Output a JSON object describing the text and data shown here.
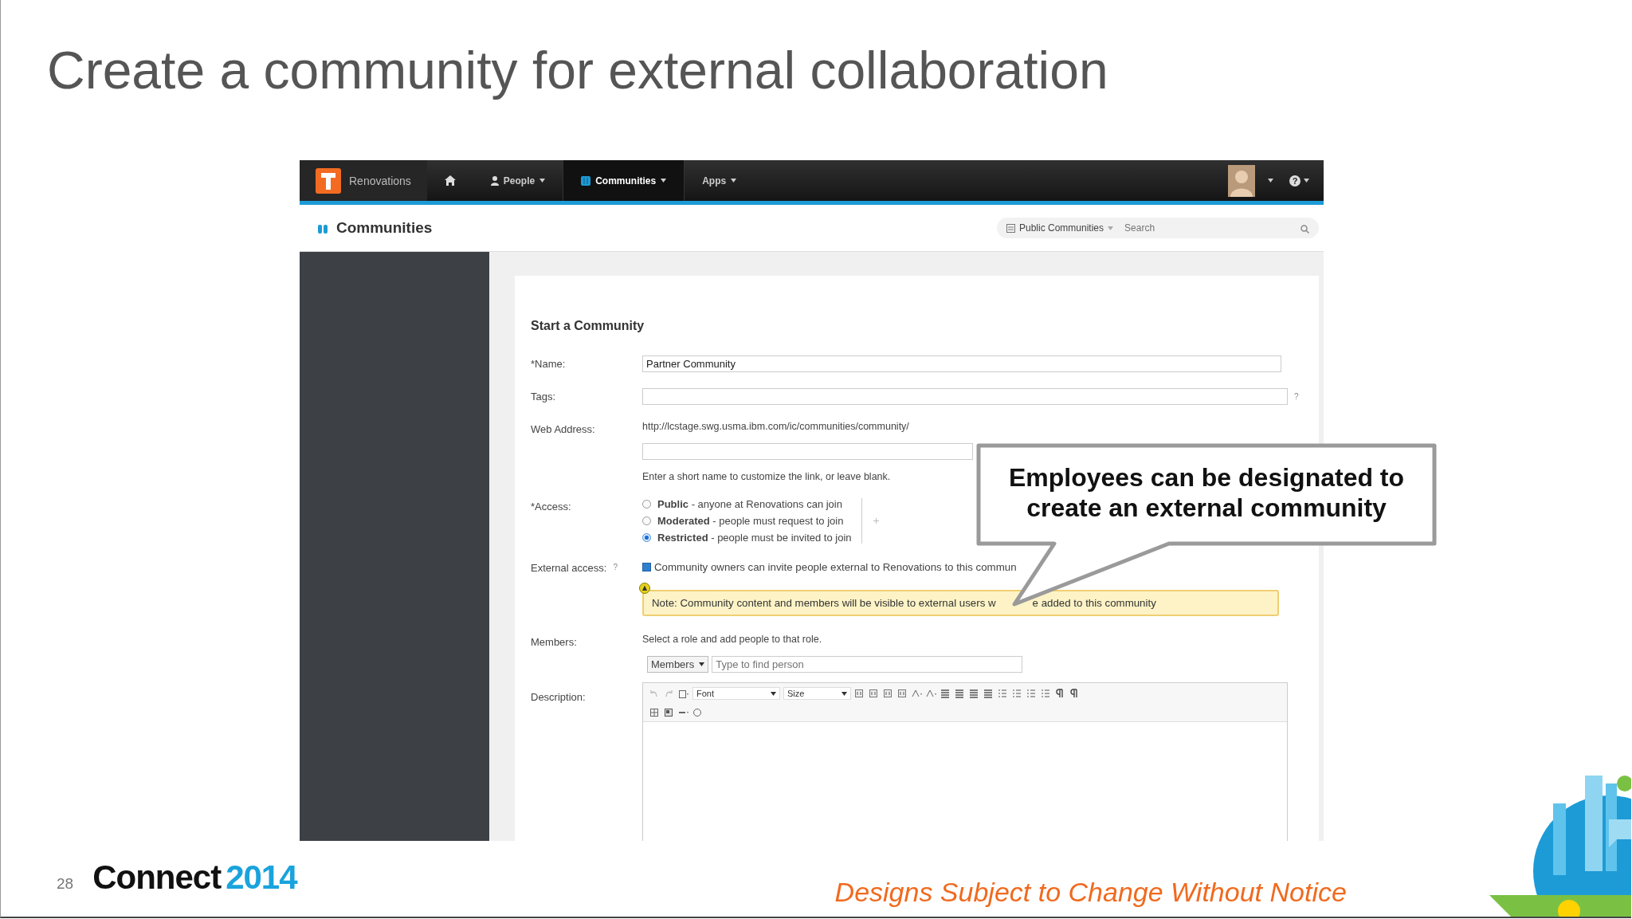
{
  "slide": {
    "title": "Create a community for external collaboration",
    "page_number": "28",
    "brand_word": "Connect",
    "brand_year": "2014",
    "disclaimer": "Designs Subject to Change Without Notice"
  },
  "app": {
    "nav": {
      "brand": "Renovations",
      "items": [
        {
          "label": "People",
          "kind": "person",
          "selected": false
        },
        {
          "label": "Communities",
          "kind": "apps",
          "selected": true
        },
        {
          "label": "Apps",
          "kind": "plain",
          "selected": false
        }
      ],
      "help": "?"
    },
    "header": {
      "title": "Communities",
      "scope": "Public Communities",
      "search": {
        "placeholder": "Search"
      }
    },
    "form": {
      "title": "Start a Community",
      "name": {
        "label": "*Name:",
        "value": "Partner Community"
      },
      "tags": {
        "label": "Tags:",
        "help": "?"
      },
      "web_address": {
        "label": "Web Address:",
        "url": "http://lcstage.swg.usma.ibm.com/ic/communities/community/",
        "hint": "Enter a short name to customize the link, or leave blank."
      },
      "access": {
        "label": "*Access:",
        "options": [
          {
            "name": "Public",
            "description": " - anyone at Renovations can join",
            "selected": false
          },
          {
            "name": "Moderated",
            "description": " - people must request to join",
            "selected": false
          },
          {
            "name": "Restricted",
            "description": " - people must be invited to join",
            "selected": true
          }
        ]
      },
      "external": {
        "label": "External access:",
        "help": "?",
        "checked": true,
        "text": "Community owners can invite people external to Renovations to this commun"
      },
      "note": {
        "parts": [
          "Note: Community content and members will be visible to external users w",
          "e added to this community"
        ]
      },
      "members": {
        "label": "Members:",
        "hint": "Select a role and add people to that role.",
        "role": "Members",
        "placeholder": "Type to find person"
      },
      "description": {
        "label": "Description:",
        "font": "Font",
        "size": "Size"
      }
    }
  },
  "callout": {
    "text": "Employees can be designated to create an external community"
  }
}
